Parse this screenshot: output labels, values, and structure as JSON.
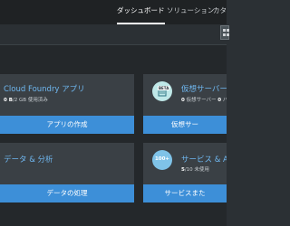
{
  "nav": {
    "tabs": [
      {
        "label": "ダッシュボード",
        "active": true
      },
      {
        "label": "ソリューション",
        "active": false
      },
      {
        "label": "カタ",
        "active": false
      }
    ]
  },
  "cards": {
    "cloud_foundry": {
      "title": "Cloud Foundry アプリ",
      "usage_value": "0 B",
      "usage_text": "/2 GB 使用済み",
      "button_label": "アプリの作成"
    },
    "virtual_servers": {
      "title": "仮想サーバー",
      "badge": "BETA",
      "meta_value1": "0",
      "meta_text1": " 仮想サーバー",
      "meta_value2": "0",
      "meta_text2": " パブ",
      "button_label": "仮想サー"
    },
    "data_analytics": {
      "title": "データ & 分析",
      "button_label": "データの処理"
    },
    "services_api": {
      "title": "サービス & AP",
      "icon_text": "100+",
      "usage_value": "5",
      "usage_text": "/10 未使用",
      "button_label": "サービスまた"
    }
  },
  "colors": {
    "accent": "#3d8fd8",
    "title_link": "#6fb7f0",
    "card_bg": "#3a4045",
    "topbar_bg": "#1f2224"
  }
}
